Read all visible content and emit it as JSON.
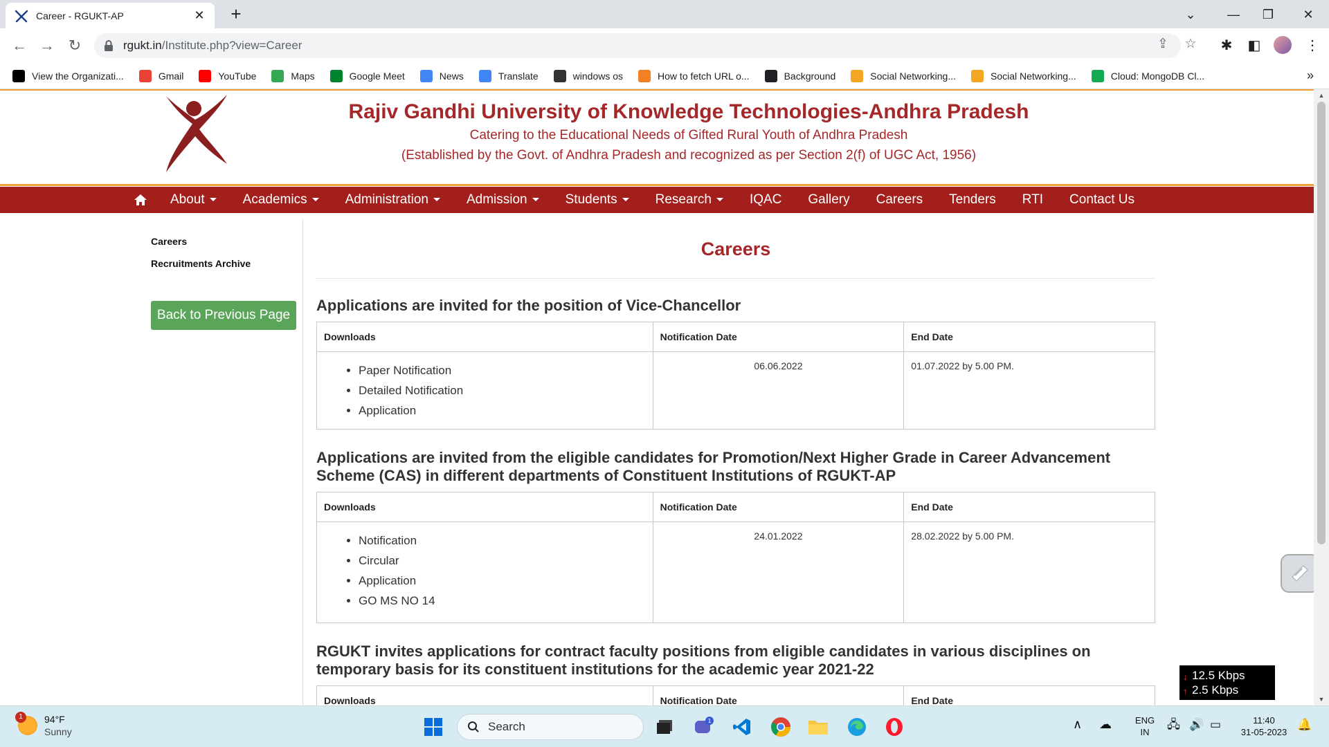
{
  "browser": {
    "tab_title": "Career - RGUKT-AP",
    "url_host": "rgukt.in",
    "url_rest": "/Institute.php?view=Career",
    "bookmarks": [
      {
        "label": "View the Organizati...",
        "color": "#000000"
      },
      {
        "label": "Gmail",
        "color": "#ea4335"
      },
      {
        "label": "YouTube",
        "color": "#ff0000"
      },
      {
        "label": "Maps",
        "color": "#34a853"
      },
      {
        "label": "Google Meet",
        "color": "#00832d"
      },
      {
        "label": "News",
        "color": "#4285f4"
      },
      {
        "label": "Translate",
        "color": "#4285f4"
      },
      {
        "label": "windows os",
        "color": "#333333"
      },
      {
        "label": "How to fetch URL o...",
        "color": "#f48024"
      },
      {
        "label": "Background",
        "color": "#202124"
      },
      {
        "label": "Social Networking...",
        "color": "#f5a623"
      },
      {
        "label": "Social Networking...",
        "color": "#f5a623"
      },
      {
        "label": "Cloud: MongoDB Cl...",
        "color": "#13aa52"
      }
    ]
  },
  "site": {
    "name": "Rajiv Gandhi University of Knowledge Technologies-Andhra Pradesh",
    "tagline": "Catering to the Educational Needs of Gifted Rural Youth of Andhra Pradesh",
    "established": "(Established by the Govt. of Andhra Pradesh and recognized as per Section 2(f) of UGC Act, 1956)",
    "brand_color": "#a31f1c",
    "accent_color": "#f0a030",
    "menu": [
      {
        "label": "About",
        "dropdown": true
      },
      {
        "label": "Academics",
        "dropdown": true
      },
      {
        "label": "Administration",
        "dropdown": true
      },
      {
        "label": "Admission",
        "dropdown": true
      },
      {
        "label": "Students",
        "dropdown": true
      },
      {
        "label": "Research",
        "dropdown": true
      },
      {
        "label": "IQAC",
        "dropdown": false
      },
      {
        "label": "Gallery",
        "dropdown": false
      },
      {
        "label": "Careers",
        "dropdown": false
      },
      {
        "label": "Tenders",
        "dropdown": false
      },
      {
        "label": "RTI",
        "dropdown": false
      },
      {
        "label": "Contact Us",
        "dropdown": false
      }
    ],
    "sidebar": {
      "links": [
        "Careers",
        "Recruitments Archive"
      ],
      "back_button": "Back to Previous Page"
    }
  },
  "main": {
    "page_title": "Careers",
    "table_headers": [
      "Downloads",
      "Notification Date",
      "End Date"
    ],
    "sections": [
      {
        "heading": "Applications are invited for the position of Vice-Chancellor",
        "downloads": [
          "Paper Notification",
          "Detailed Notification",
          "Application"
        ],
        "notification_date": "06.06.2022",
        "end_date": "01.07.2022 by 5.00 PM."
      },
      {
        "heading": "Applications are invited from the eligible candidates for Promotion/Next Higher Grade in Career Advancement Scheme (CAS) in different departments of Constituent Institutions of RGUKT-AP",
        "downloads": [
          "Notification",
          "Circular",
          "Application",
          "GO MS NO 14"
        ],
        "notification_date": "24.01.2022",
        "end_date": "28.02.2022 by 5.00 PM."
      },
      {
        "heading": "RGUKT invites applications for contract faculty positions from eligible candidates in various disciplines on temporary basis for its constituent institutions for the academic year 2021-22",
        "downloads": [],
        "notification_date": "",
        "end_date": ""
      }
    ]
  },
  "overlay": {
    "net_down": "12.5 Kbps",
    "net_up": "2.5 Kbps"
  },
  "taskbar": {
    "weather_temp": "94°F",
    "weather_desc": "Sunny",
    "weather_badge": "1",
    "search_label": "Search",
    "teams_badge": "1",
    "lang_line1": "ENG",
    "lang_line2": "IN",
    "time": "11:40",
    "date": "31-05-2023"
  }
}
